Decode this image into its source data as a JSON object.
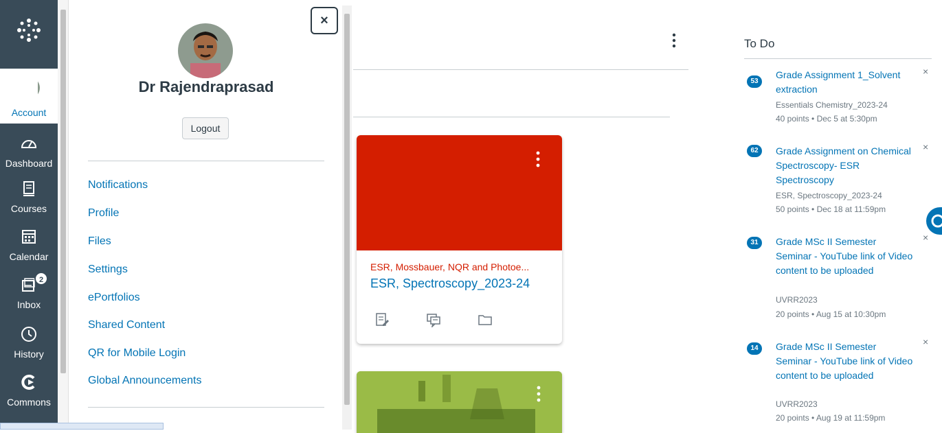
{
  "global_nav": {
    "account_label": "Account",
    "dashboard_label": "Dashboard",
    "courses_label": "Courses",
    "calendar_label": "Calendar",
    "inbox_label": "Inbox",
    "inbox_badge": "2",
    "history_label": "History",
    "commons_label": "Commons"
  },
  "account_tray": {
    "close_label": "×",
    "user_name": "Dr Rajendraprasad",
    "logout_label": "Logout",
    "links": [
      "Notifications",
      "Profile",
      "Files",
      "Settings",
      "ePortfolios",
      "Shared Content",
      "QR for Mobile Login",
      "Global Announcements"
    ]
  },
  "course_card": {
    "term": "ESR, Mossbauer, NQR and Photoe...",
    "title": "ESR, Spectroscopy_2023-24",
    "color": "#d41e00"
  },
  "todo": {
    "title": "To Do",
    "items": [
      {
        "badge": "53",
        "title": "Grade Assignment 1_Solvent extraction",
        "course": "Essentials Chemistry_2023-24",
        "meta": "40 points • Dec 5 at 5:30pm"
      },
      {
        "badge": "62",
        "title": "Grade Assignment on Chemical Spectroscopy- ESR Spectroscopy",
        "course": "ESR, Spectroscopy_2023-24",
        "meta": "50 points • Dec 18 at 11:59pm"
      },
      {
        "badge": "31",
        "title": "Grade MSc II Semester Seminar - YouTube link of Video content to be uploaded",
        "course": "UVRR2023",
        "meta": "20 points • Aug 15 at 10:30pm"
      },
      {
        "badge": "14",
        "title": "Grade MSc II Semester Seminar - YouTube link of Video content to be uploaded",
        "course": "UVRR2023",
        "meta": "20 points • Aug 19 at 11:59pm"
      }
    ],
    "dismiss_label": "×"
  },
  "colors": {
    "nav_bg": "#394b58",
    "link_blue": "#0374b5",
    "card_red": "#d41e00"
  }
}
